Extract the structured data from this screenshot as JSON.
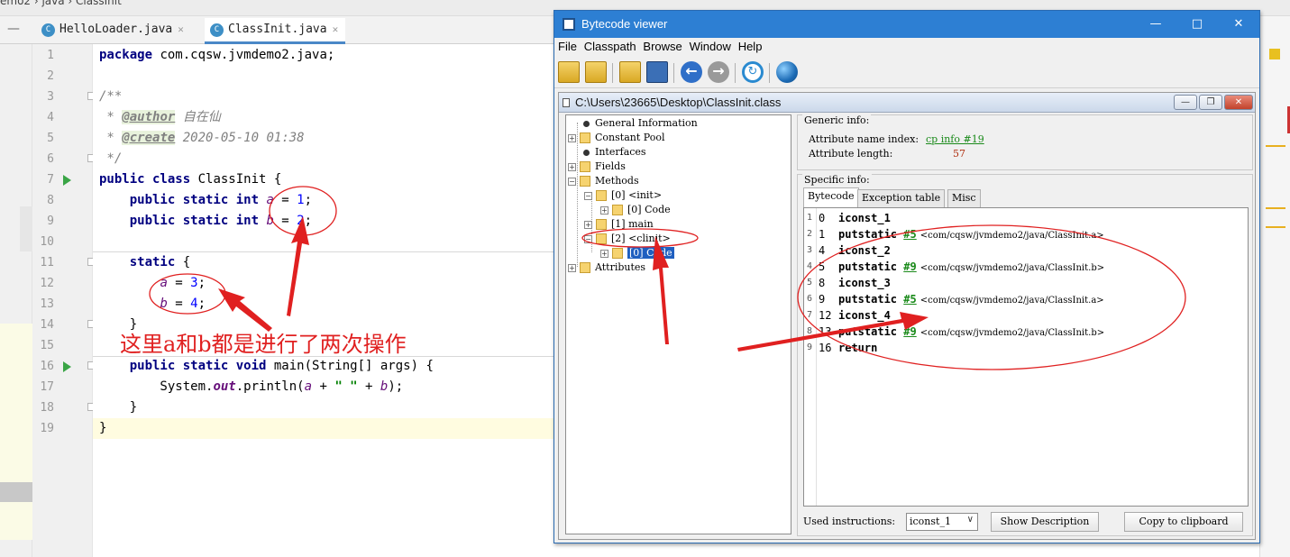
{
  "ide": {
    "breadcrumb": "emo2 › java › ClassInit",
    "tabs": [
      {
        "label": "HelloLoader.java",
        "active": false
      },
      {
        "label": "ClassInit.java",
        "active": true
      }
    ],
    "line_numbers": [
      "1",
      "2",
      "3",
      "4",
      "5",
      "6",
      "7",
      "8",
      "9",
      "10",
      "11",
      "12",
      "13",
      "14",
      "15",
      "16",
      "17",
      "18",
      "19"
    ],
    "code": {
      "l1_kw": "package",
      "l1_rest": " com.cqsw.jvmdemo2.java;",
      "l3": "/**",
      "l4_star": " * ",
      "l4_tag": "@author",
      "l4_val": " 自在仙",
      "l5_star": " * ",
      "l5_tag": "@create",
      "l5_val": " 2020-05-10 01:38",
      "l6": " */",
      "l7_kw": "public class",
      "l7_rest": " ClassInit {",
      "l8_kw": "    public static int ",
      "l8_fld": "a",
      "l8_eq": " = ",
      "l8_num": "1",
      "l8_end": ";",
      "l9_kw": "    public static int ",
      "l9_fld": "b",
      "l9_eq": " = ",
      "l9_num": "2",
      "l9_end": ";",
      "l11_kw": "    static",
      "l11_rest": " {",
      "l12_ind": "        ",
      "l12_fld": "a",
      "l12_eq": " = ",
      "l12_num": "3",
      "l12_end": ";",
      "l13_ind": "        ",
      "l13_fld": "b",
      "l13_eq": " = ",
      "l13_num": "4",
      "l13_end": ";",
      "l14": "    }",
      "l16_kw": "    public static void",
      "l16_rest": " main(String[] args) {",
      "l17_a": "        System.",
      "l17_out": "out",
      "l17_b": ".println(",
      "l17_fa": "a",
      "l17_c": " + ",
      "l17_s": "\" \"",
      "l17_d": " + ",
      "l17_fb": "b",
      "l17_e": ");",
      "l18": "    }",
      "l19": "}"
    },
    "annotation_text": "这里a和b都是进行了两次操作"
  },
  "viewer": {
    "window_title": "Bytecode viewer",
    "menu": [
      "File",
      "Classpath",
      "Browse",
      "Window",
      "Help"
    ],
    "toolbar": {
      "open_icon": "open-class-icon",
      "open_jar_icon": "open-jar-icon",
      "folder_icon": "open-folder-icon",
      "save_icon": "save-icon",
      "back_icon": "back-icon",
      "forward_icon": "forward-icon",
      "refresh_icon": "refresh-icon",
      "web_icon": "web-icon"
    },
    "inner_title": "C:\\Users\\23665\\Desktop\\ClassInit.class",
    "tree": {
      "general": "General Information",
      "constant_pool": "Constant Pool",
      "interfaces": "Interfaces",
      "fields": "Fields",
      "methods": "Methods",
      "m0": "[0] <init>",
      "m0_code": "[0] Code",
      "m1": "[1] main",
      "m2": "[2] <clinit>",
      "m2_code": "[0] Code",
      "attributes": "Attributes"
    },
    "generic_info": {
      "title": "Generic info:",
      "name_index_label": "Attribute name index:",
      "name_index_value": "cp info #19",
      "length_label": "Attribute length:",
      "length_value": "57"
    },
    "specific_info": {
      "title": "Specific info:",
      "tabs": [
        "Bytecode",
        "Exception table",
        "Misc"
      ]
    },
    "bytecode": [
      {
        "row": "1",
        "offset": "0",
        "op": "iconst_1",
        "ref": "",
        "comment": ""
      },
      {
        "row": "2",
        "offset": "1",
        "op": "putstatic",
        "ref": "#5",
        "comment": "<com/cqsw/jvmdemo2/java/ClassInit.a>"
      },
      {
        "row": "3",
        "offset": "4",
        "op": "iconst_2",
        "ref": "",
        "comment": ""
      },
      {
        "row": "4",
        "offset": "5",
        "op": "putstatic",
        "ref": "#9",
        "comment": "<com/cqsw/jvmdemo2/java/ClassInit.b>"
      },
      {
        "row": "5",
        "offset": "8",
        "op": "iconst_3",
        "ref": "",
        "comment": ""
      },
      {
        "row": "6",
        "offset": "9",
        "op": "putstatic",
        "ref": "#5",
        "comment": "<com/cqsw/jvmdemo2/java/ClassInit.a>"
      },
      {
        "row": "7",
        "offset": "12",
        "op": "iconst_4",
        "ref": "",
        "comment": ""
      },
      {
        "row": "8",
        "offset": "13",
        "op": "putstatic",
        "ref": "#9",
        "comment": "<com/cqsw/jvmdemo2/java/ClassInit.b>"
      },
      {
        "row": "9",
        "offset": "16",
        "op": "return",
        "ref": "",
        "comment": ""
      }
    ],
    "bottom": {
      "used_label": "Used instructions:",
      "used_value": "iconst_1",
      "show_desc": "Show Description",
      "copy": "Copy to clipboard"
    }
  },
  "colors": {
    "annotation_red": "#e02020",
    "title_blue": "#2d7fd3",
    "keyword": "#000080",
    "field": "#660e7a",
    "link_green": "#1a8a1a"
  }
}
